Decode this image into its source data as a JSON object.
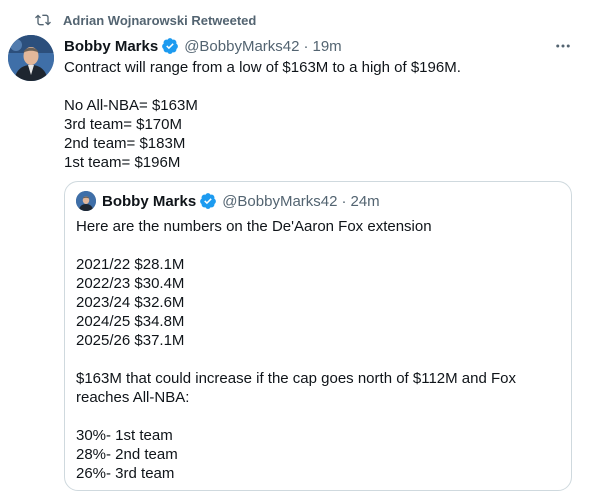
{
  "retweet": {
    "text": "Adrian Wojnarowski Retweeted",
    "icon": "retweet-icon"
  },
  "tweet": {
    "name": "Bobby Marks",
    "handle": "@BobbyMarks42",
    "separator": "·",
    "time": "19m",
    "lines": [
      "Contract will range from a low of $163M to a high of $196M.",
      "",
      "No All-NBA= $163M",
      "3rd team= $170M",
      "2nd team= $183M",
      "1st team= $196M"
    ]
  },
  "quote": {
    "name": "Bobby Marks",
    "handle": "@BobbyMarks42",
    "separator": "·",
    "time": "24m",
    "lines": [
      "Here are the numbers on the De'Aaron Fox extension",
      "",
      "2021/22 $28.1M",
      "2022/23 $30.4M",
      "2023/24 $32.6M",
      "2024/25 $34.8M",
      "2025/26 $37.1M",
      "",
      "$163M that could increase if the cap goes north of $112M and Fox reaches All-NBA:",
      "",
      "30%- 1st team",
      "28%- 2nd team",
      "26%- 3rd team"
    ]
  },
  "colors": {
    "verified": "#1d9bf0",
    "secondary": "#536471",
    "border": "#cfd9de"
  }
}
